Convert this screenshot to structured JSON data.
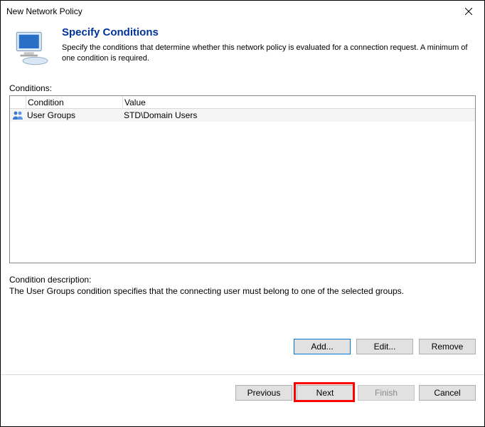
{
  "window": {
    "title": "New Network Policy"
  },
  "header": {
    "title": "Specify Conditions",
    "subtitle": "Specify the conditions that determine whether this network policy is evaluated for a connection request. A minimum of one condition is required."
  },
  "conditions": {
    "section_label": "Conditions:",
    "columns": {
      "icon": "",
      "condition": "Condition",
      "value": "Value"
    },
    "rows": [
      {
        "icon": "user-groups-icon",
        "condition": "User Groups",
        "value": "STD\\Domain Users"
      }
    ],
    "description_label": "Condition description:",
    "description_text": "The User Groups condition specifies that the connecting user must belong to one of the selected groups."
  },
  "buttons": {
    "add": "Add...",
    "edit": "Edit...",
    "remove": "Remove",
    "previous": "Previous",
    "next": "Next",
    "finish": "Finish",
    "cancel": "Cancel"
  }
}
